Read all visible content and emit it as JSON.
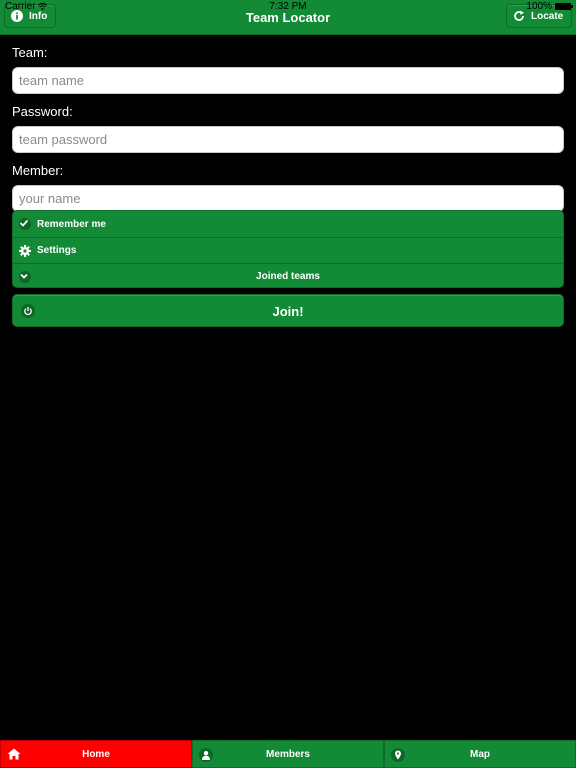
{
  "status_bar": {
    "carrier": "Carrier",
    "time": "7:32 PM",
    "battery": "100%"
  },
  "header": {
    "title": "Team Locator",
    "info_button": "Info",
    "locate_button": "Locate"
  },
  "form": {
    "team_label": "Team:",
    "team_placeholder": "team name",
    "password_label": "Password:",
    "password_placeholder": "team password",
    "member_label": "Member:",
    "member_placeholder": "your name"
  },
  "options": {
    "remember_me": "Remember me",
    "settings": "Settings",
    "joined_teams": "Joined teams"
  },
  "join_button": "Join!",
  "tabs": [
    {
      "label": "Home",
      "icon": "home-icon",
      "active": true
    },
    {
      "label": "Members",
      "icon": "user-icon",
      "active": false
    },
    {
      "label": "Map",
      "icon": "map-pin-icon",
      "active": false
    }
  ],
  "colors": {
    "primary_green": "#138a35",
    "active_tab_red": "#ff0000",
    "background": "#000000"
  }
}
